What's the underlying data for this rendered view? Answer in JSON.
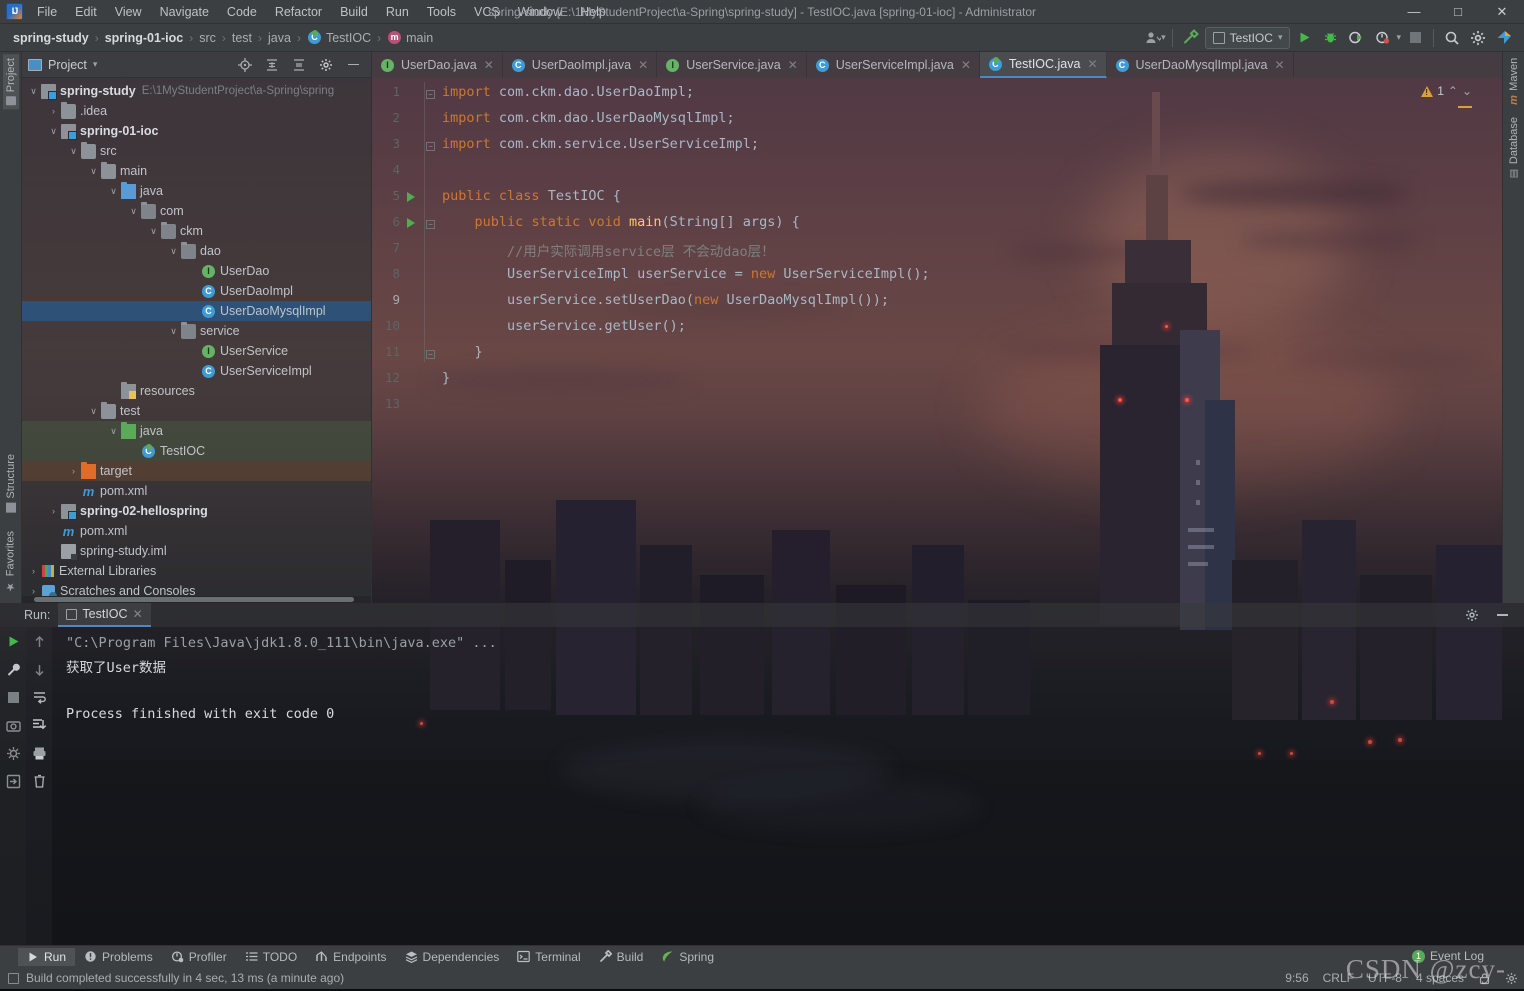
{
  "window": {
    "title": "spring-study [E:\\1MyStudentProject\\a-Spring\\spring-study] - TestIOC.java [spring-01-ioc] - Administrator",
    "minimize": "—",
    "maximize": "□",
    "close": "✕"
  },
  "menubar": {
    "items": [
      "File",
      "Edit",
      "View",
      "Navigate",
      "Code",
      "Refactor",
      "Build",
      "Run",
      "Tools",
      "VCS",
      "Window",
      "Help"
    ]
  },
  "breadcrumb": {
    "items": [
      {
        "label": "spring-study",
        "bold": true,
        "icon": ""
      },
      {
        "label": "spring-01-ioc",
        "bold": true,
        "icon": ""
      },
      {
        "label": "src",
        "bold": false,
        "icon": ""
      },
      {
        "label": "test",
        "bold": false,
        "icon": ""
      },
      {
        "label": "java",
        "bold": false,
        "icon": ""
      },
      {
        "label": "TestIOC",
        "bold": false,
        "icon": "class-icon"
      },
      {
        "label": "main",
        "bold": false,
        "icon": "method-icon"
      }
    ],
    "separator": "›"
  },
  "toolbar": {
    "run_config": "TestIOC",
    "dropdown_caret": "▾",
    "icons": [
      "user-avatar-icon",
      "build-hammer-icon",
      "run-icon",
      "debug-icon",
      "run-with-coverage-icon",
      "profiler-icon",
      "stop-icon",
      "search-everywhere-icon",
      "settings-gear-icon",
      "updates-icon"
    ]
  },
  "project_panel": {
    "title": "Project",
    "header_icons": [
      "locate-icon",
      "expand-all-icon",
      "collapse-all-icon",
      "gear-icon",
      "hide-icon"
    ],
    "tree": [
      {
        "depth": 0,
        "label": "spring-study",
        "bold": true,
        "icon": "module-icon",
        "arrow": "∨",
        "path": "E:\\1MyStudentProject\\a-Spring\\spring",
        "state": "none"
      },
      {
        "depth": 1,
        "label": ".idea",
        "bold": false,
        "icon": "folder-icon",
        "arrow": "›",
        "path": "",
        "state": "none"
      },
      {
        "depth": 1,
        "label": "spring-01-ioc",
        "bold": true,
        "icon": "module-icon",
        "arrow": "∨",
        "path": "",
        "state": "none"
      },
      {
        "depth": 2,
        "label": "src",
        "bold": false,
        "icon": "folder-icon",
        "arrow": "∨",
        "path": "",
        "state": "none"
      },
      {
        "depth": 3,
        "label": "main",
        "bold": false,
        "icon": "folder-icon",
        "arrow": "∨",
        "path": "",
        "state": "none"
      },
      {
        "depth": 4,
        "label": "java",
        "bold": false,
        "icon": "source-folder-icon",
        "arrow": "∨",
        "path": "",
        "state": "none"
      },
      {
        "depth": 5,
        "label": "com",
        "bold": false,
        "icon": "package-icon",
        "arrow": "∨",
        "path": "",
        "state": "none"
      },
      {
        "depth": 6,
        "label": "ckm",
        "bold": false,
        "icon": "package-icon",
        "arrow": "∨",
        "path": "",
        "state": "none"
      },
      {
        "depth": 7,
        "label": "dao",
        "bold": false,
        "icon": "package-icon",
        "arrow": "∨",
        "path": "",
        "state": "none"
      },
      {
        "depth": 8,
        "label": "UserDao",
        "bold": false,
        "icon": "interface-icon",
        "arrow": "",
        "path": "",
        "state": "none"
      },
      {
        "depth": 8,
        "label": "UserDaoImpl",
        "bold": false,
        "icon": "class-icon",
        "arrow": "",
        "path": "",
        "state": "none"
      },
      {
        "depth": 8,
        "label": "UserDaoMysqlImpl",
        "bold": false,
        "icon": "class-icon",
        "arrow": "",
        "path": "",
        "state": "selected"
      },
      {
        "depth": 7,
        "label": "service",
        "bold": false,
        "icon": "package-icon",
        "arrow": "∨",
        "path": "",
        "state": "none"
      },
      {
        "depth": 8,
        "label": "UserService",
        "bold": false,
        "icon": "interface-icon",
        "arrow": "",
        "path": "",
        "state": "none"
      },
      {
        "depth": 8,
        "label": "UserServiceImpl",
        "bold": false,
        "icon": "class-icon",
        "arrow": "",
        "path": "",
        "state": "none"
      },
      {
        "depth": 4,
        "label": "resources",
        "bold": false,
        "icon": "resources-folder-icon",
        "arrow": "",
        "path": "",
        "state": "none"
      },
      {
        "depth": 3,
        "label": "test",
        "bold": false,
        "icon": "folder-icon",
        "arrow": "∨",
        "path": "",
        "state": "none"
      },
      {
        "depth": 4,
        "label": "java",
        "bold": false,
        "icon": "test-folder-icon",
        "arrow": "∨",
        "path": "",
        "state": "green"
      },
      {
        "depth": 5,
        "label": "TestIOC",
        "bold": false,
        "icon": "test-class-icon",
        "arrow": "",
        "path": "",
        "state": "green"
      },
      {
        "depth": 2,
        "label": "target",
        "bold": false,
        "icon": "target-folder-icon",
        "arrow": "›",
        "path": "",
        "state": "orange"
      },
      {
        "depth": 2,
        "label": "pom.xml",
        "bold": false,
        "icon": "maven-icon",
        "arrow": "",
        "path": "",
        "state": "none"
      },
      {
        "depth": 1,
        "label": "spring-02-hellospring",
        "bold": true,
        "icon": "module-icon",
        "arrow": "›",
        "path": "",
        "state": "none"
      },
      {
        "depth": 1,
        "label": "pom.xml",
        "bold": false,
        "icon": "maven-icon",
        "arrow": "",
        "path": "",
        "state": "none"
      },
      {
        "depth": 1,
        "label": "spring-study.iml",
        "bold": false,
        "icon": "iml-icon",
        "arrow": "",
        "path": "",
        "state": "none"
      },
      {
        "depth": 0,
        "label": "External Libraries",
        "bold": false,
        "icon": "libraries-icon",
        "arrow": "›",
        "path": "",
        "state": "none"
      },
      {
        "depth": 0,
        "label": "Scratches and Consoles",
        "bold": false,
        "icon": "scratches-icon",
        "arrow": "›",
        "path": "",
        "state": "none"
      }
    ]
  },
  "editor": {
    "tabs": [
      {
        "label": "UserDao.java",
        "icon": "interface-icon",
        "active": false
      },
      {
        "label": "UserDaoImpl.java",
        "icon": "class-icon",
        "active": false
      },
      {
        "label": "UserService.java",
        "icon": "interface-icon",
        "active": false
      },
      {
        "label": "UserServiceImpl.java",
        "icon": "class-icon",
        "active": false
      },
      {
        "label": "TestIOC.java",
        "icon": "test-class-icon",
        "active": true
      },
      {
        "label": "UserDaoMysqlImpl.java",
        "icon": "class-icon",
        "active": false
      }
    ],
    "close_glyph": "✕",
    "warning_count": "1",
    "line_numbers": [
      "1",
      "2",
      "3",
      "4",
      "5",
      "6",
      "7",
      "8",
      "9",
      "10",
      "11",
      "12",
      "13"
    ],
    "code_lines": [
      "import com.ckm.dao.UserDaoImpl;",
      "import com.ckm.dao.UserDaoMysqlImpl;",
      "import com.ckm.service.UserServiceImpl;",
      "",
      "public class TestIOC {",
      "    public static void main(String[] args) {",
      "        //用户实际调用service层 不会动dao层！",
      "        UserServiceImpl userService = new UserServiceImpl();",
      "        userService.setUserDao(new UserDaoMysqlImpl());",
      "        userService.getUser();",
      "    }",
      "}",
      ""
    ]
  },
  "run_window": {
    "label": "Run:",
    "tab": "TestIOC",
    "close_glyph": "✕",
    "console": [
      "\"C:\\Program Files\\Java\\jdk1.8.0_111\\bin\\java.exe\" ...",
      "获取了User数据",
      "Process finished with exit code 0"
    ],
    "gutter_icons_left": [
      "rerun-icon",
      "wrench-settings-icon",
      "stop-icon",
      "camera-icon",
      "thread-dump-icon",
      "exit-icon"
    ],
    "gutter_icons_right": [
      "up-arrow-icon",
      "down-arrow-icon",
      "soft-wrap-icon",
      "scroll-to-end-icon",
      "print-icon",
      "trash-icon"
    ]
  },
  "left_strip": {
    "top": [
      "Project"
    ],
    "bottom": [
      "Structure",
      "Favorites"
    ]
  },
  "right_strip": {
    "items": [
      "Maven",
      "Database"
    ]
  },
  "bottom_bar": {
    "items": [
      {
        "label": "Run",
        "icon": "run-icon",
        "active": true
      },
      {
        "label": "Problems",
        "icon": "problems-icon",
        "active": false
      },
      {
        "label": "Profiler",
        "icon": "profiler-icon",
        "active": false
      },
      {
        "label": "TODO",
        "icon": "todo-icon",
        "active": false
      },
      {
        "label": "Endpoints",
        "icon": "endpoints-icon",
        "active": false
      },
      {
        "label": "Dependencies",
        "icon": "dependencies-icon",
        "active": false
      },
      {
        "label": "Terminal",
        "icon": "terminal-icon",
        "active": false
      },
      {
        "label": "Build",
        "icon": "build-icon",
        "active": false
      },
      {
        "label": "Spring",
        "icon": "spring-leaf-icon",
        "active": false
      }
    ]
  },
  "status_bar": {
    "message": "Build completed successfully in 4 sec, 13 ms (a minute ago)",
    "caret_position": "9:56",
    "line_separator": "CRLF",
    "encoding": "UTF-8",
    "indent": "4 spaces",
    "event_log": "Event Log",
    "event_badge": "1"
  },
  "watermark": {
    "text": "CSDN @zcy-"
  },
  "colors": {
    "accent_blue": "#4a88c7",
    "selection_blue": "#2d5177",
    "keyword_orange": "#cc7832",
    "comment_gray": "#808080",
    "method_yellow": "#ffc66d",
    "warning_yellow": "#d8a13a",
    "chrome_gray": "#3c3f41"
  }
}
